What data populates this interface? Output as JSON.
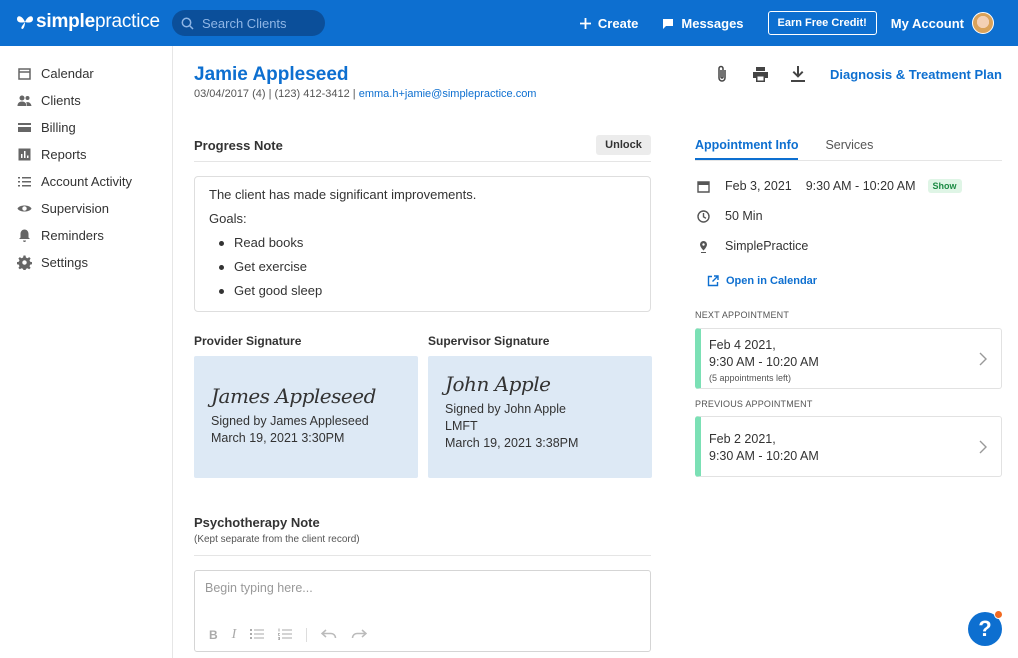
{
  "brand": {
    "logo_bold": "simple",
    "logo_light": "practice",
    "primary_color": "#0d6fd0"
  },
  "search": {
    "placeholder": "Search Clients"
  },
  "topbar": {
    "create": "Create",
    "messages": "Messages",
    "credit": "Earn Free Credit!",
    "account": "My Account"
  },
  "sidebar": {
    "items": [
      {
        "label": "Calendar",
        "icon": "calendar-icon"
      },
      {
        "label": "Clients",
        "icon": "clients-icon"
      },
      {
        "label": "Billing",
        "icon": "billing-icon"
      },
      {
        "label": "Reports",
        "icon": "reports-icon"
      },
      {
        "label": "Account Activity",
        "icon": "list-icon"
      },
      {
        "label": "Supervision",
        "icon": "eye-icon"
      },
      {
        "label": "Reminders",
        "icon": "bell-icon"
      },
      {
        "label": "Settings",
        "icon": "gear-icon"
      }
    ]
  },
  "client": {
    "name": "Jamie Appleseed",
    "meta": "03/04/2017 (4) | (123) 412-3412 | ",
    "email": "emma.h+jamie@simplepractice.com"
  },
  "header_actions": {
    "diagnosis_link": "Diagnosis & Treatment Plan"
  },
  "progress_note": {
    "title": "Progress Note",
    "unlock": "Unlock",
    "line1": "The client has made significant improvements.",
    "goals_label": "Goals:",
    "goals": [
      "Read books",
      "Get exercise",
      "Get good sleep"
    ]
  },
  "signatures": {
    "provider": {
      "label": "Provider Signature",
      "script": "James Appleseed",
      "signed_by": "Signed by James Appleseed",
      "date": "March 19, 2021 3:30PM"
    },
    "supervisor": {
      "label": "Supervisor Signature",
      "script": "John Apple",
      "signed_by": "Signed by John Apple",
      "credential": "LMFT",
      "date": "March 19, 2021 3:38PM"
    }
  },
  "psychotherapy": {
    "title": "Psychotherapy Note",
    "subtitle": "(Kept separate from the client record)",
    "placeholder": "Begin typing here..."
  },
  "appointment": {
    "tabs": [
      "Appointment Info",
      "Services"
    ],
    "date": "Feb 3, 2021",
    "time": "9:30 AM - 10:20 AM",
    "status": "Show",
    "duration": "50 Min",
    "location": "SimplePractice",
    "open_calendar": "Open in Calendar",
    "next_label": "NEXT APPOINTMENT",
    "next_date": "Feb 4 2021,",
    "next_time": "9:30 AM - 10:20 AM",
    "next_note": "(5 appointments left)",
    "prev_label": "PREVIOUS APPOINTMENT",
    "prev_date": "Feb 2 2021,",
    "prev_time": "9:30 AM - 10:20 AM"
  },
  "help": {
    "label": "?"
  }
}
